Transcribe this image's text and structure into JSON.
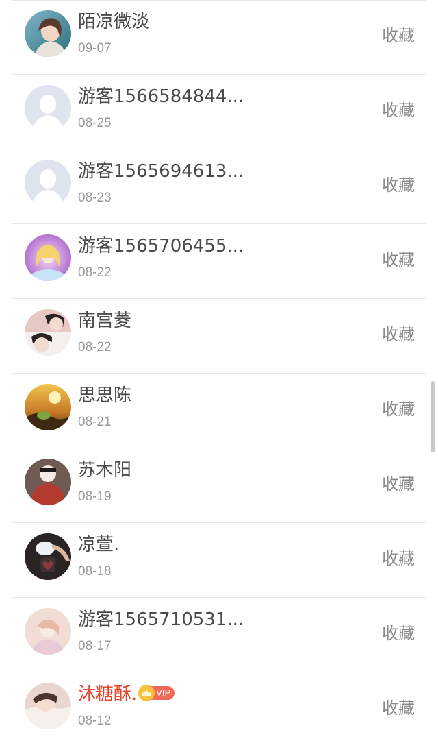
{
  "items": [
    {
      "name": "陌凉微淡",
      "date": "09-07",
      "action": "收藏",
      "vip": false,
      "avatar": "photo-girl-blue"
    },
    {
      "name": "游客1566584844...",
      "date": "08-25",
      "action": "收藏",
      "vip": false,
      "avatar": "default-user"
    },
    {
      "name": "游客1565694613...",
      "date": "08-23",
      "action": "收藏",
      "vip": false,
      "avatar": "default-user"
    },
    {
      "name": "游客1565706455...",
      "date": "08-22",
      "action": "收藏",
      "vip": false,
      "avatar": "photo-anime-purple"
    },
    {
      "name": "南宫菱",
      "date": "08-22",
      "action": "收藏",
      "vip": false,
      "avatar": "photo-two-boys"
    },
    {
      "name": "思思陈",
      "date": "08-21",
      "action": "收藏",
      "vip": false,
      "avatar": "photo-sunset"
    },
    {
      "name": "苏木阳",
      "date": "08-19",
      "action": "收藏",
      "vip": false,
      "avatar": "photo-person-red"
    },
    {
      "name": "凉萱.",
      "date": "08-18",
      "action": "收藏",
      "vip": false,
      "avatar": "photo-heart-dark"
    },
    {
      "name": "游客1565710531...",
      "date": "08-17",
      "action": "收藏",
      "vip": false,
      "avatar": "photo-pastel"
    },
    {
      "name": "沐糖酥.",
      "date": "08-12",
      "action": "收藏",
      "vip": true,
      "vip_label": "VIP",
      "avatar": "photo-sleeping-girl"
    }
  ],
  "colors": {
    "name": "#4a4a4a",
    "vip_name": "#e8452a",
    "date": "#9a9a9a",
    "action": "#8a8a8a",
    "divider": "#e6e6e6",
    "vip_tag": "#ef6a59",
    "vip_crown": "#f6c23e"
  }
}
